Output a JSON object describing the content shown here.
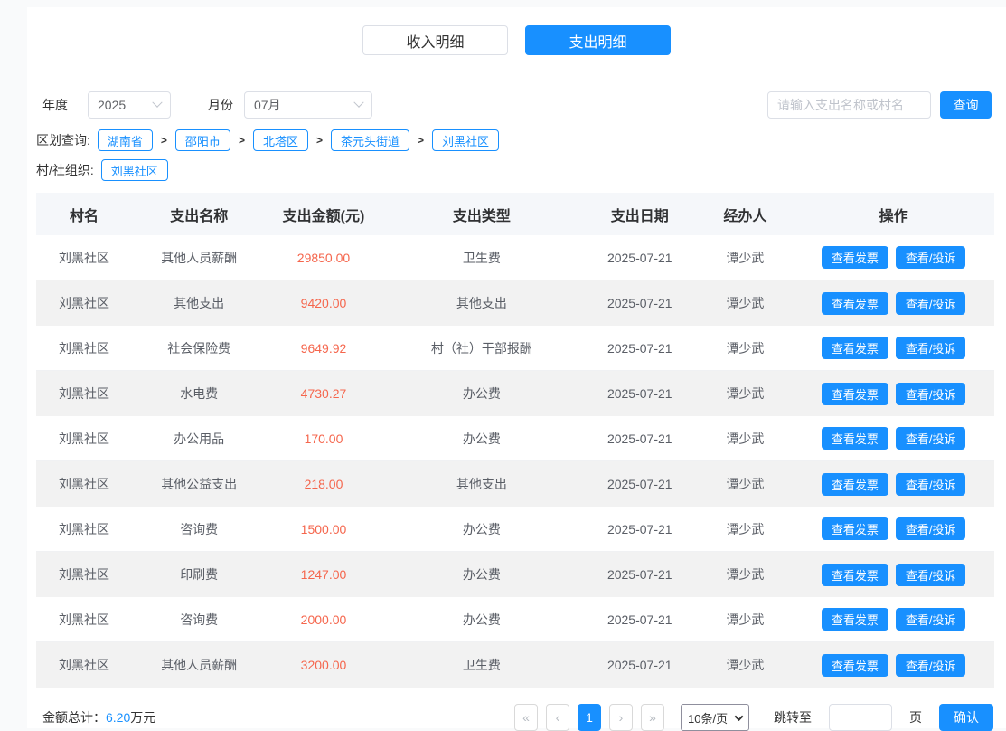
{
  "tabs": {
    "income": "收入明细",
    "expense": "支出明细"
  },
  "filters": {
    "year_label": "年度",
    "year_value": "2025",
    "month_label": "月份",
    "month_value": "07月",
    "search_placeholder": "请输入支出名称或村名",
    "search_button": "查询"
  },
  "region": {
    "label": "区划查询:",
    "separator": ">",
    "path": [
      "湖南省",
      "邵阳市",
      "北塔区",
      "茶元头街道",
      "刘黑社区"
    ],
    "org_label": "村/社组织:",
    "org_value": "刘黑社区"
  },
  "table": {
    "columns": [
      "村名",
      "支出名称",
      "支出金额(元)",
      "支出类型",
      "支出日期",
      "经办人",
      "操作"
    ],
    "action_buttons": {
      "invoice": "查看发票",
      "complaint": "查看/投诉"
    },
    "rows": [
      {
        "village": "刘黑社区",
        "name": "其他人员薪酬",
        "amount": "29850.00",
        "type": "卫生费",
        "date": "2025-07-21",
        "operator": "谭少武"
      },
      {
        "village": "刘黑社区",
        "name": "其他支出",
        "amount": "9420.00",
        "type": "其他支出",
        "date": "2025-07-21",
        "operator": "谭少武"
      },
      {
        "village": "刘黑社区",
        "name": "社会保险费",
        "amount": "9649.92",
        "type": "村（社）干部报酬",
        "date": "2025-07-21",
        "operator": "谭少武"
      },
      {
        "village": "刘黑社区",
        "name": "水电费",
        "amount": "4730.27",
        "type": "办公费",
        "date": "2025-07-21",
        "operator": "谭少武"
      },
      {
        "village": "刘黑社区",
        "name": "办公用品",
        "amount": "170.00",
        "type": "办公费",
        "date": "2025-07-21",
        "operator": "谭少武"
      },
      {
        "village": "刘黑社区",
        "name": "其他公益支出",
        "amount": "218.00",
        "type": "其他支出",
        "date": "2025-07-21",
        "operator": "谭少武"
      },
      {
        "village": "刘黑社区",
        "name": "咨询费",
        "amount": "1500.00",
        "type": "办公费",
        "date": "2025-07-21",
        "operator": "谭少武"
      },
      {
        "village": "刘黑社区",
        "name": "印刷费",
        "amount": "1247.00",
        "type": "办公费",
        "date": "2025-07-21",
        "operator": "谭少武"
      },
      {
        "village": "刘黑社区",
        "name": "咨询费",
        "amount": "2000.00",
        "type": "办公费",
        "date": "2025-07-21",
        "operator": "谭少武"
      },
      {
        "village": "刘黑社区",
        "name": "其他人员薪酬",
        "amount": "3200.00",
        "type": "卫生费",
        "date": "2025-07-21",
        "operator": "谭少武"
      }
    ]
  },
  "footer": {
    "total_label": "金额总计：",
    "total_value": "6.20",
    "total_unit": "万元",
    "pagination": {
      "first": "«",
      "prev": "‹",
      "current_page": "1",
      "next": "›",
      "last": "»",
      "page_size": "10条/页",
      "jump_label": "跳转至",
      "page_unit": "页",
      "confirm": "确认"
    }
  },
  "colors": {
    "accent": "#1890ff",
    "amount_text": "#f5664d",
    "header_bg": "#f5f7fa",
    "alt_row_bg": "#f2f2f2",
    "page_bg": "#f9fafb"
  }
}
